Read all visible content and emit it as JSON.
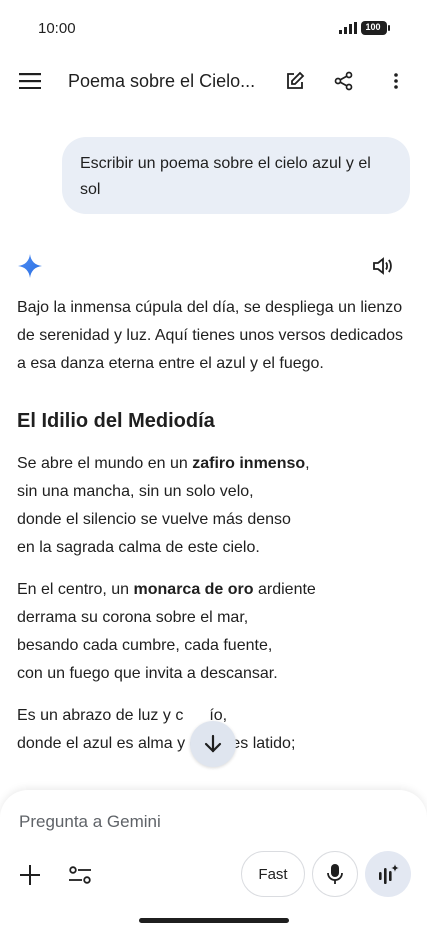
{
  "status_bar": {
    "time": "10:00",
    "battery": "100"
  },
  "header": {
    "title": "Poema sobre el Cielo..."
  },
  "user_message": {
    "text": "Escribir un poema sobre el cielo azul y el sol"
  },
  "response": {
    "intro": "Bajo la inmensa cúpula del día, se despliega un lienzo de serenidad y luz. Aquí tienes unos versos dedicados a esa danza eterna entre el azul y el fuego.",
    "poem_title": "El Idilio del Mediodía",
    "stanza1": {
      "l1_pre": "Se abre el mundo en un ",
      "l1_bold": "zafiro inmenso",
      "l1_post": ",",
      "l2": "sin una mancha, sin un solo velo,",
      "l3": "donde el silencio se vuelve más denso",
      "l4": "en la sagrada calma de este cielo."
    },
    "stanza2": {
      "l1_pre": "En el centro, un ",
      "l1_bold": "monarca de oro",
      "l1_post": " ardiente",
      "l2": "derrama su corona sobre el mar,",
      "l3": "besando cada cumbre, cada fuente,",
      "l4": "con un fuego que invita a descansar."
    },
    "stanza3": {
      "l1_a": "Es un abrazo de luz y c",
      "l1_b": "ío,",
      "l2": "donde el azul es alma y el sol es latido;"
    }
  },
  "composer": {
    "placeholder": "Pregunta a Gemini",
    "mode_label": "Fast"
  },
  "colors": {
    "user_bubble": "#e9eef6",
    "gemini_blue": "#4285f4",
    "live_button": "#e3e8f2"
  }
}
